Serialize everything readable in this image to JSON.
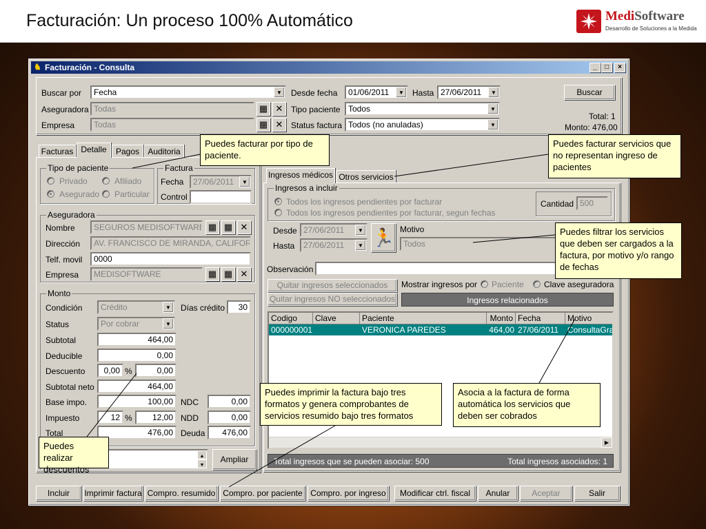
{
  "slide": {
    "title": "Facturación: Un proceso 100% Automático",
    "logo_name_a": "Medi",
    "logo_name_b": "Software",
    "logo_tagline": "Desarrollo de Soluciones a la Medida"
  },
  "window": {
    "title": "Facturación - Consulta"
  },
  "search": {
    "buscar_por_label": "Buscar por",
    "buscar_por_value": "Fecha",
    "aseguradora_label": "Aseguradora",
    "aseguradora_value": "Todas",
    "empresa_label": "Empresa",
    "empresa_value": "Todas",
    "desde_label": "Desde fecha",
    "desde_value": "01/06/2011",
    "hasta_label": "Hasta",
    "hasta_value": "27/06/2011",
    "tipo_pac_label": "Tipo paciente",
    "tipo_pac_value": "Todos",
    "status_label": "Status factura",
    "status_value": "Todos (no anuladas)",
    "buscar_btn": "Buscar",
    "total": "Total: 1",
    "monto": "Monto: 476,00"
  },
  "left_tabs": [
    "Facturas",
    "Detalle",
    "Pagos",
    "Auditoria"
  ],
  "tipo_paciente": {
    "title": "Tipo de paciente",
    "privado": "Privado",
    "afiliado": "Afiliado",
    "asegurado": "Asegurado",
    "particular": "Particular"
  },
  "factura": {
    "title": "Factura",
    "fecha_label": "Fecha",
    "fecha_value": "27/06/2011",
    "control_label": "Control"
  },
  "aseguradora": {
    "title": "Aseguradora",
    "nombre_label": "Nombre",
    "nombre_value": "SEGUROS MEDISOFTWARE",
    "direccion_label": "Dirección",
    "direccion_value": "AV. FRANCISCO DE MIRANDA, CALIFORNI",
    "telf_label": "Telf. movil",
    "telf_value": "0000",
    "empresa_label": "Empresa",
    "empresa_value": "MEDISOFTWARE"
  },
  "monto": {
    "title": "Monto",
    "condicion_label": "Condición",
    "condicion_value": "Crédito",
    "dias_label": "Días crédito",
    "dias_value": "30",
    "status_label": "Status",
    "status_value": "Por cobrar",
    "subtotal_label": "Subtotal",
    "subtotal_value": "464,00",
    "deducible_label": "Deducible",
    "deducible_value": "0,00",
    "descuento_label": "Descuento",
    "descuento_pct": "0,00",
    "descuento_value": "0,00",
    "pct": "%",
    "subtotal_neto_label": "Subtotal neto",
    "subtotal_neto_value": "464,00",
    "base_label": "Base impo.",
    "base_value": "100,00",
    "ndc_label": "NDC",
    "ndc_value": "0,00",
    "impuesto_label": "Impuesto",
    "impuesto_pct": "12",
    "impuesto_value": "12,00",
    "ndd_label": "NDD",
    "ndd_value": "0,00",
    "total_label": "Total",
    "total_value": "476,00",
    "deuda_label": "Deuda",
    "deuda_value": "476,00",
    "ampliar_btn": "Ampliar"
  },
  "right_tabs": [
    "Ingresos médicos",
    "Otros servicios"
  ],
  "ingresos": {
    "title": "Ingresos a incluir",
    "opt1": "Todos los ingresos pendientes por facturar",
    "opt2": "Todos los ingresos pendientes por facturar, segun fechas",
    "cantidad_label": "Cantidad",
    "cantidad_value": "500",
    "desde_label": "Desde",
    "desde_value": "27/06/2011",
    "hasta_label": "Hasta",
    "hasta_value": "27/06/2011",
    "motivo_label": "Motivo",
    "motivo_value": "Todos",
    "observacion_label": "Observación",
    "quitar_sel": "Quitar ingresos seleccionados",
    "quitar_no_sel": "Quitar ingresos NO seleccionados",
    "mostrar_label": "Mostrar ingresos por",
    "paciente_opt": "Paciente",
    "clave_opt": "Clave aseguradora",
    "relacionados": "Ingresos relacionados"
  },
  "grid": {
    "columns": [
      "Codigo",
      "Clave",
      "Paciente",
      "Monto",
      "Fecha",
      "Motivo"
    ],
    "rows": [
      [
        "000000001",
        "",
        "VERONICA PAREDES",
        "464,00",
        "27/06/2011",
        "ConsultaGral"
      ]
    ]
  },
  "status_bar": {
    "left": "Total ingresos que se pueden asociar: 500",
    "right": "Total ingresos asociados: 1"
  },
  "bottom_buttons": [
    "Incluir",
    "Imprimir factura",
    "Compro. resumido",
    "Compro. por paciente",
    "Compro. por ingreso",
    "Modificar ctrl. fiscal",
    "Anular",
    "Aceptar",
    "Salir"
  ],
  "callouts": {
    "c1": "Puedes facturar por tipo de paciente.",
    "c2": "Puedes facturar servicios que no representan ingreso de pacientes",
    "c3": "Puedes filtrar los servicios que deben ser cargados a la factura, por motivo y/o rango de fechas",
    "c4": "Puedes imprimir la factura bajo tres formatos y genera comprobantes de servicios resumido bajo tres formatos",
    "c5": "Asocia a la factura de forma automática los servicios que deben ser cobrados",
    "c6": "Puedes realizar descuentos"
  }
}
